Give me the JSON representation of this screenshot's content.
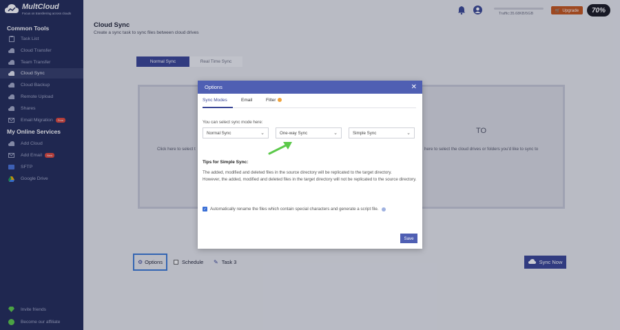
{
  "app": {
    "logo_name": "MultCloud",
    "logo_tagline": "Focus on transferring across clouds"
  },
  "sidebar": {
    "common_tools_title": "Common Tools",
    "common_tools": [
      {
        "label": "Task List",
        "icon": "clipboard-icon"
      },
      {
        "label": "Cloud Transfer",
        "icon": "cloud-transfer-icon"
      },
      {
        "label": "Team Transfer",
        "icon": "team-transfer-icon"
      },
      {
        "label": "Cloud Sync",
        "icon": "cloud-sync-icon",
        "active": true
      },
      {
        "label": "Cloud Backup",
        "icon": "cloud-backup-icon"
      },
      {
        "label": "Remote Upload",
        "icon": "remote-upload-icon"
      },
      {
        "label": "Shares",
        "icon": "shares-icon"
      },
      {
        "label": "Email Migration",
        "icon": "email-migration-icon",
        "badge": "Free"
      }
    ],
    "online_services_title": "My Online Services",
    "online_services": [
      {
        "label": "Add Cloud",
        "icon": "add-cloud-icon"
      },
      {
        "label": "Add Email",
        "icon": "add-email-icon",
        "badge": "New"
      },
      {
        "label": "SFTP",
        "icon": "sftp-icon"
      },
      {
        "label": "Google Drive",
        "icon": "google-drive-icon"
      }
    ],
    "bottom": [
      {
        "label": "Invite friends",
        "icon": "diamond-icon"
      },
      {
        "label": "Become our affiliate",
        "icon": "dollar-icon"
      }
    ]
  },
  "topbar": {
    "traffic": "Traffic:35.68KB/5GB",
    "upgrade_label": "Upgrade",
    "promo": "70%"
  },
  "main": {
    "title": "Cloud Sync",
    "subtitle": "Create a sync task to sync files between cloud drives",
    "tabs": [
      "Normal Sync",
      "Real Time Sync"
    ],
    "source_hint": "Click here to select t",
    "to_label": "TO",
    "target_hint": "here to select the cloud drives or folders you'd like to sync to",
    "options_label": "Options",
    "schedule_label": "Schedule",
    "task_label": "Task 3",
    "sync_now_label": "Sync Now"
  },
  "modal": {
    "title": "Options",
    "tabs": [
      "Sync Modes",
      "Email",
      "Filter"
    ],
    "mode_label": "You can select sync mode here:",
    "selects": [
      "Normal Sync",
      "One-way Sync",
      "Simple Sync"
    ],
    "tips_title": "Tips for Simple Sync:",
    "tips_line1": "The added, modified and deleted files in the source directory will be replicated to the target directory.",
    "tips_line2": "However, the added, modified and deleted files in the target directory will not be replicated to the source directory.",
    "auto_rename": "Automatically rename the files which contain special characters and generate a script file.",
    "save_label": "Save"
  },
  "colors": {
    "sidebar_bg": "#232c59",
    "accent": "#3a4696",
    "modal_header": "#4f5fb3",
    "upgrade": "#c6561b",
    "arrow": "#5cc94a"
  }
}
